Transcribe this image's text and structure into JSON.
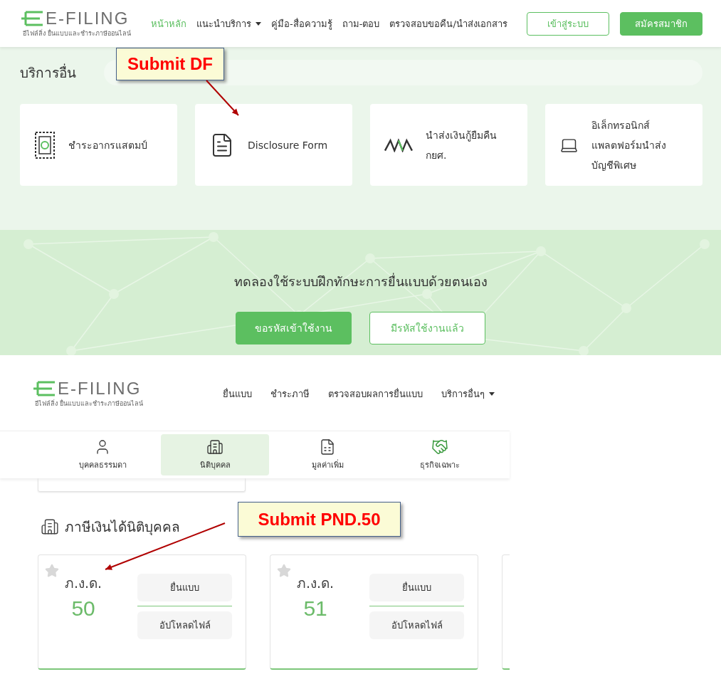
{
  "top_page": {
    "logo": {
      "title": "E-FILING",
      "subtitle": "อีไฟล์ลิ่ง ยื่นแบบและชำระภาษีออนไลน์"
    },
    "nav": [
      {
        "label": "หน้าหลัก",
        "selected": true,
        "dropdown": false
      },
      {
        "label": "แนะนำบริการ",
        "selected": false,
        "dropdown": true
      },
      {
        "label": "คู่มือ-สื่อความรู้",
        "selected": false,
        "dropdown": false
      },
      {
        "label": "ถาม-ตอบ",
        "selected": false,
        "dropdown": false
      },
      {
        "label": "ตรวจสอบขอคืน/นำส่งเอกสาร",
        "selected": false,
        "dropdown": false
      }
    ],
    "login_button": "เข้าสู่ระบบ",
    "register_button": "สมัครสมาชิก",
    "services": {
      "title": "บริการอื่น",
      "items": [
        {
          "kind": "stamp",
          "label": "ชำระอากรแสตมป์"
        },
        {
          "kind": "document",
          "label": "Disclosure Form"
        },
        {
          "kind": "zigzag",
          "label": "นำส่งเงินกู้ยืมคืน กยศ."
        },
        {
          "kind": "laptop",
          "label": "อิเล็กทรอนิกส์ แพลตฟอร์มนำส่ง บัญชีพิเศษ"
        }
      ]
    },
    "banner": {
      "text": "ทดลองใช้ระบบฝึกทักษะการยื่นแบบด้วยตนเอง",
      "primary_button": "ขอรหัสเข้าใช้งาน",
      "secondary_button": "มีรหัสใช้งานแล้ว"
    }
  },
  "bottom_page": {
    "logo": {
      "title": "E-FILING",
      "subtitle": "อีไฟล์ลิ่ง ยื่นแบบและชำระภาษีออนไลน์"
    },
    "nav": [
      {
        "label": "ยื่นแบบ",
        "dropdown": false
      },
      {
        "label": "ชำระภาษี",
        "dropdown": false
      },
      {
        "label": "ตรวจสอบผลการยื่นแบบ",
        "dropdown": false
      },
      {
        "label": "บริการอื่นๆ",
        "dropdown": true
      }
    ],
    "tabs": [
      {
        "kind": "person",
        "label": "บุคคลธรรมดา",
        "selected": false
      },
      {
        "kind": "building",
        "label": "นิติบุคคล",
        "selected": true
      },
      {
        "kind": "document",
        "label": "มูลค่าเพิ่ม",
        "selected": false
      },
      {
        "kind": "handshake",
        "label": "ธุรกิจเฉพาะ",
        "selected": false
      }
    ],
    "section_title": "ภาษีเงินได้นิติบุคคล",
    "forms": [
      {
        "name": "ภ.ง.ด.",
        "number": "50",
        "favorite": false,
        "actions": [
          "ยื่นแบบ",
          "อัปโหลดไฟล์"
        ]
      },
      {
        "name": "ภ.ง.ด.",
        "number": "51",
        "favorite": false,
        "actions": [
          "ยื่นแบบ",
          "อัปโหลดไฟล์"
        ]
      }
    ]
  },
  "annotations": [
    {
      "text": "Submit DF"
    },
    {
      "text": "Submit PND.50"
    }
  ]
}
